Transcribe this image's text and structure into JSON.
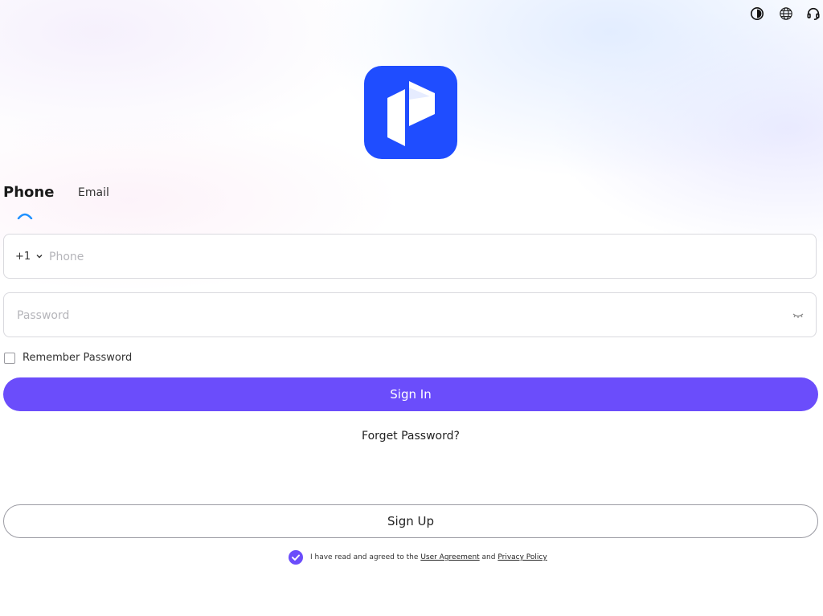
{
  "toolbar": {
    "icons": [
      "theme-contrast-icon",
      "globe-icon",
      "headset-support-icon"
    ]
  },
  "logo": {
    "color": "#1f4dff"
  },
  "tabs": [
    {
      "label": "Phone",
      "active": true
    },
    {
      "label": "Email",
      "active": false
    }
  ],
  "phone_field": {
    "country_code": "+1",
    "placeholder": "Phone",
    "value": ""
  },
  "password_field": {
    "placeholder": "Password",
    "value": ""
  },
  "remember": {
    "label": "Remember Password",
    "checked": false
  },
  "buttons": {
    "sign_in": "Sign In",
    "forget_password": "Forget Password?",
    "sign_up": "Sign Up"
  },
  "agreement": {
    "checked": true,
    "prefix": "I have read and agreed to the",
    "user_agreement": "User Agreement",
    "and": "and",
    "privacy_policy": "Privacy Policy"
  },
  "colors": {
    "accent": "#6b4dfb",
    "tab_indicator": "#1e90ff"
  }
}
